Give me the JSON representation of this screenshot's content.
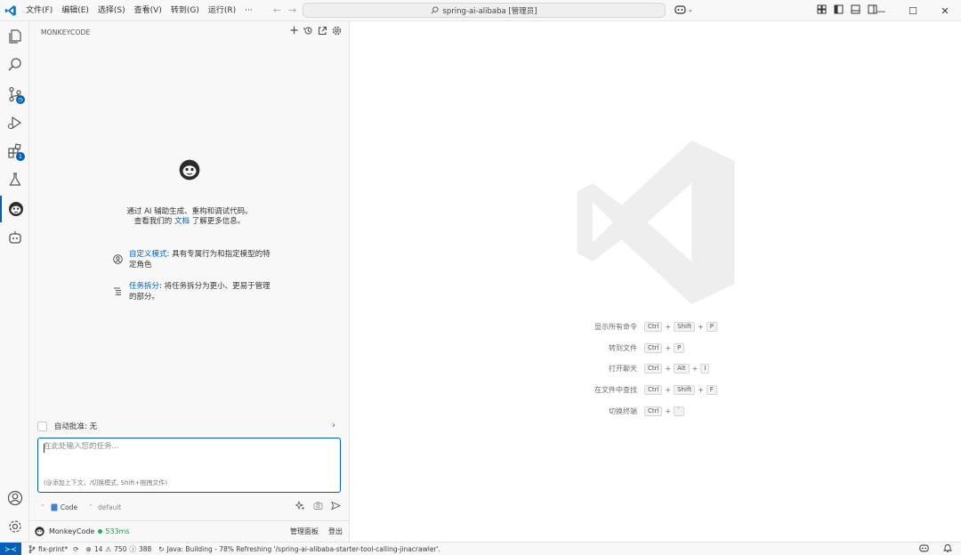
{
  "titlebar": {
    "menu": [
      "文件(F)",
      "编辑(E)",
      "选择(S)",
      "查看(V)",
      "转到(G)",
      "运行(R)",
      "···"
    ],
    "search": "spring-ai-alibaba [管理员]"
  },
  "sidebar": {
    "title": "MONKEYCODE",
    "intro_line1": "通过 AI 辅助生成、重构和调试代码。",
    "intro_line2_prefix": "查看我们的 ",
    "intro_link": "文档",
    "intro_line2_suffix": " 了解更多信息。",
    "features": [
      {
        "title": "自定义模式",
        "text": ": 具有专属行为和指定模型的特定角色",
        "icon": "user-circle-icon"
      },
      {
        "title": "任务拆分",
        "text": ": 将任务拆分为更小、更易于管理的部分。",
        "icon": "list-tree-icon"
      }
    ],
    "auto_approve": "自动批准: 无",
    "task_placeholder": "在此处输入您的任务...",
    "task_hint": "(@添加上下文，/切换模式, Shift+拖拽文件)",
    "mode": "Code",
    "profile": "default",
    "footer": {
      "name": "MonkeyCode",
      "latency": "533ms",
      "panel": "管理面板",
      "logout": "登出"
    }
  },
  "activity": {
    "extensions_badge": "1"
  },
  "editor": {
    "shortcuts": [
      {
        "label": "显示所有命令",
        "keys": [
          "Ctrl",
          "Shift",
          "P"
        ]
      },
      {
        "label": "转到文件",
        "keys": [
          "Ctrl",
          "P"
        ]
      },
      {
        "label": "打开聊天",
        "keys": [
          "Ctrl",
          "Alt",
          "I"
        ]
      },
      {
        "label": "在文件中查找",
        "keys": [
          "Ctrl",
          "Shift",
          "F"
        ]
      },
      {
        "label": "切换终端",
        "keys": [
          "Ctrl",
          "`"
        ]
      }
    ]
  },
  "statusbar": {
    "branch": "fix-print*",
    "errors": "14",
    "warnings": "750",
    "infos": "388",
    "java": "Java: Building - 78% Refreshing '/spring-ai-alibaba-starter-tool-calling-jinacrawler'."
  }
}
